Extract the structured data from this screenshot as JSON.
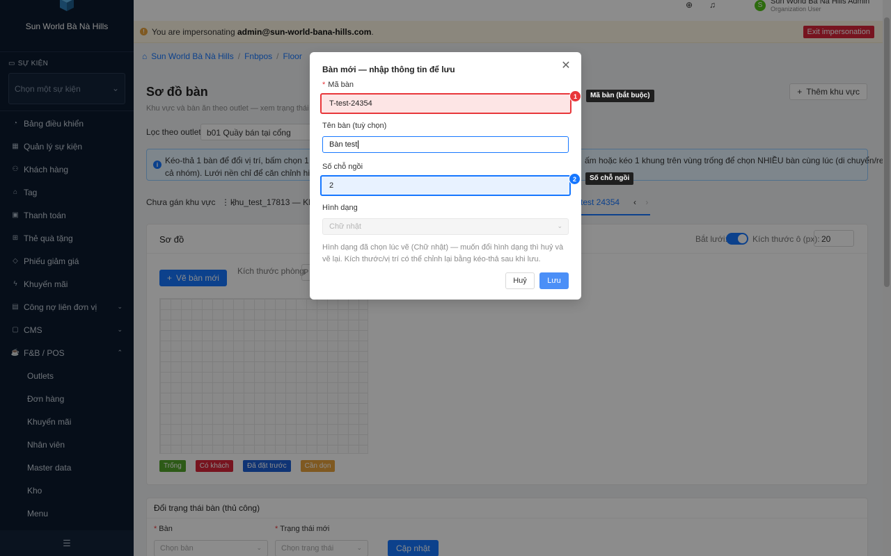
{
  "sidebar": {
    "brand": "Sun World Bà Nà Hills",
    "event_section": "SỰ KIỆN",
    "event_placeholder": "Chọn một sự kiện",
    "items": [
      {
        "label": "Bảng điều khiển",
        "icon": "dashboard-icon"
      },
      {
        "label": "Quản lý sự kiện",
        "icon": "calendar-icon"
      },
      {
        "label": "Khách hàng",
        "icon": "users-icon"
      },
      {
        "label": "Tag",
        "icon": "tag-icon"
      },
      {
        "label": "Thanh toán",
        "icon": "payment-icon"
      },
      {
        "label": "Thẻ quà tặng",
        "icon": "gift-icon"
      },
      {
        "label": "Phiếu giảm giá",
        "icon": "coupon-icon"
      },
      {
        "label": "Khuyến mãi",
        "icon": "promo-icon"
      },
      {
        "label": "Công nợ liên đơn vị",
        "icon": "debt-icon"
      },
      {
        "label": "CMS",
        "icon": "cms-icon"
      },
      {
        "label": "F&B / POS",
        "icon": "fnb-icon"
      }
    ],
    "sub_items": [
      "Outlets",
      "Đơn hàng",
      "Khuyến mãi",
      "Nhân viên",
      "Master data",
      "Kho",
      "Menu"
    ]
  },
  "topbar": {
    "user_initial": "S",
    "user_name": "Sun World Bà Nà Hills Admin",
    "user_role": "Organization User"
  },
  "impersonation": {
    "prefix": "You are impersonating",
    "email": "admin@sun-world-bana-hills.com",
    "suffix": ".",
    "exit_label": "Exit impersonation"
  },
  "breadcrumb": [
    "Sun World Bà Nà Hills",
    "Fnbpos",
    "Floor"
  ],
  "page": {
    "title": "Sơ đồ bàn",
    "subtitle": "Khu vực và bàn ăn theo outlet — xem trạng thái bà",
    "add_area": "Thêm khu vực",
    "filter_label": "Lọc theo outlet:",
    "filter_value": "b01 Quầy bán tại cổng",
    "info_left_1": "Kéo-thả 1 bàn để đổi vị trí, bấm chọn 1 bàn đ",
    "info_left_2": "cả nhóm). Lưới nền chỉ để căn chỉnh hiển thị,",
    "info_right_1": "ấm hoặc kéo 1 khung trên vùng trống để chọn NHIỀU bàn cùng lúc (di chuyển/resize",
    "tab_unassigned": "Chưa gán khu vực",
    "tab_area": "khu_test_17813 — Khu te",
    "tab_active": "test 24354"
  },
  "floor_card": {
    "title": "Sơ đồ",
    "grid_label": "Bắt lưới:",
    "cell_label": "Kích thước ô (px):",
    "cell_value": "20",
    "draw_button": "Vẽ bàn mới",
    "room_label": "Kích thước phòng:",
    "room_value": "P"
  },
  "legend": [
    {
      "label": "Trống",
      "color": "#52a52a"
    },
    {
      "label": "Có khách",
      "color": "#d9263a"
    },
    {
      "label": "Đã đặt trước",
      "color": "#1d5fd6"
    },
    {
      "label": "Cần dọn",
      "color": "#e8a33c"
    }
  ],
  "status_card": {
    "title": "Đổi trạng thái bàn (thủ công)",
    "table_label": "Bàn",
    "table_placeholder": "Chọn bàn",
    "status_label": "Trạng thái mới",
    "status_placeholder": "Chọn trạng thái",
    "update_button": "Cập nhật"
  },
  "modal": {
    "title": "Bàn mới — nhập thông tin để lưu",
    "code_label": "Mã bàn",
    "code_value": "T-test-24354",
    "name_label": "Tên bàn (tuỳ chọn)",
    "name_value": "Bàn test",
    "seats_label": "Số chỗ ngồi",
    "seats_value": "2",
    "shape_label": "Hình dạng",
    "shape_value": "Chữ nhật",
    "hint": "Hình dạng đã chọn lúc vẽ (Chữ nhật) — muốn đổi hình dạng thì huỷ và vẽ lại. Kích thước/vị trí có thể chỉnh lại bằng kéo-thả sau khi lưu.",
    "cancel": "Huỷ",
    "save": "Lưu"
  },
  "annotations": [
    {
      "number": "1",
      "label": "Mã bàn (bắt buộc)"
    },
    {
      "number": "2",
      "label": "Số chỗ ngồi"
    }
  ]
}
